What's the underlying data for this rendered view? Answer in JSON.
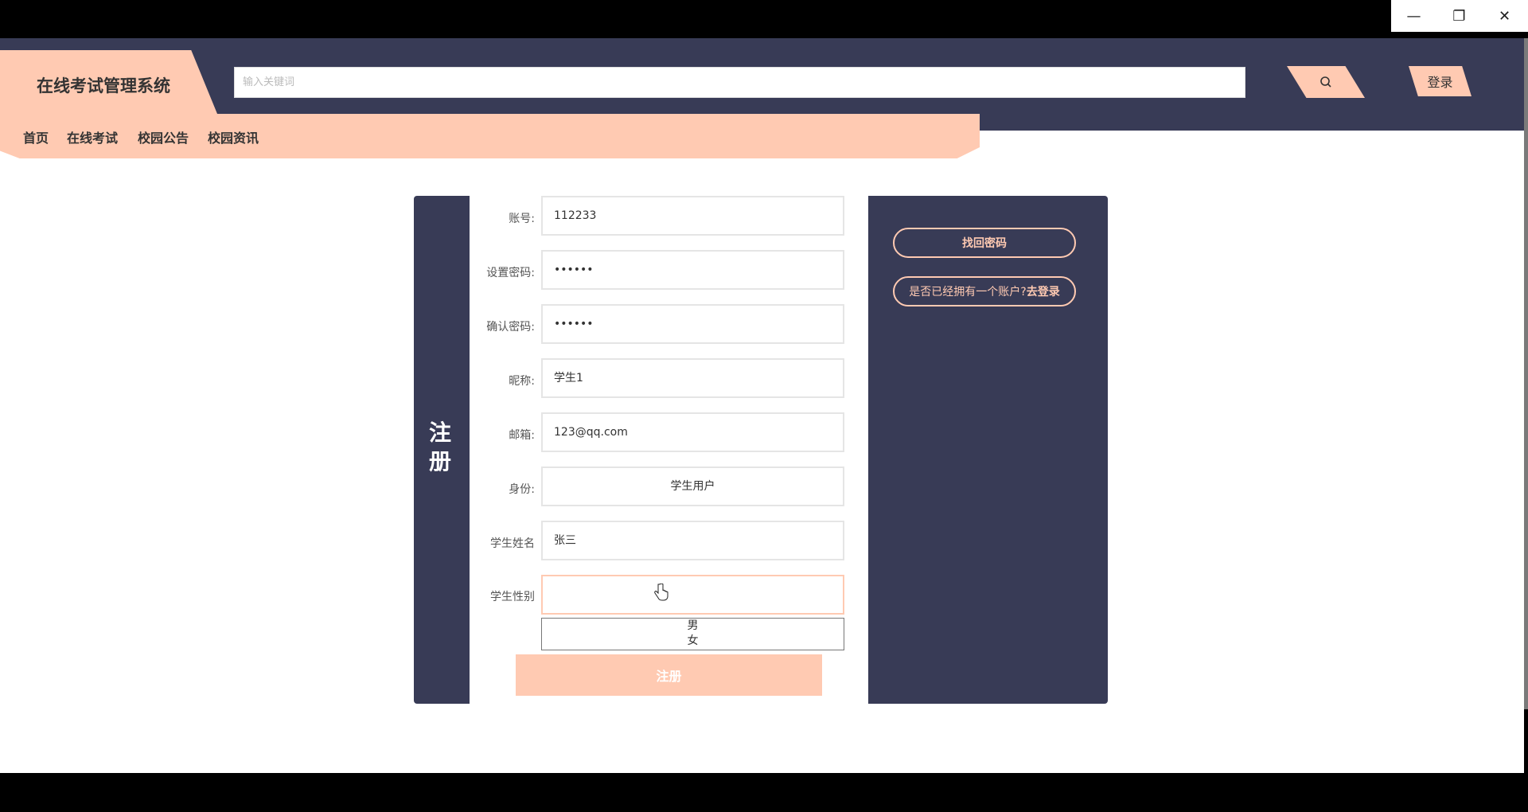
{
  "window": {
    "minimize_icon": "minimize-icon",
    "restore_icon": "restore-icon",
    "close_icon": "close-icon"
  },
  "header": {
    "title": "在线考试管理系统",
    "search_placeholder": "输入关键词",
    "search_icon": "search-icon",
    "login_label": "登录"
  },
  "nav": {
    "items": [
      "首页",
      "在线考试",
      "校园公告",
      "校园资讯"
    ]
  },
  "register": {
    "side_title": "注册",
    "fields": [
      {
        "label": "账号:",
        "value": "112233"
      },
      {
        "label": "设置密码:",
        "value": "••••••"
      },
      {
        "label": "确认密码:",
        "value": "••••••"
      },
      {
        "label": "昵称:",
        "value": "学生1"
      },
      {
        "label": "邮箱:",
        "value": "123@qq.com"
      },
      {
        "label": "身份:",
        "value": "学生用户"
      },
      {
        "label": "学生姓名",
        "value": "张三"
      },
      {
        "label": "学生性别",
        "value": ""
      }
    ],
    "gender_options": [
      "男",
      "女"
    ],
    "submit_label": "注册",
    "forgot_password": "找回密码",
    "have_account": "是否已经拥有一个账户?",
    "go_login": "去登录"
  },
  "colors": {
    "dark": "#383b56",
    "accent": "#ffcab2"
  }
}
